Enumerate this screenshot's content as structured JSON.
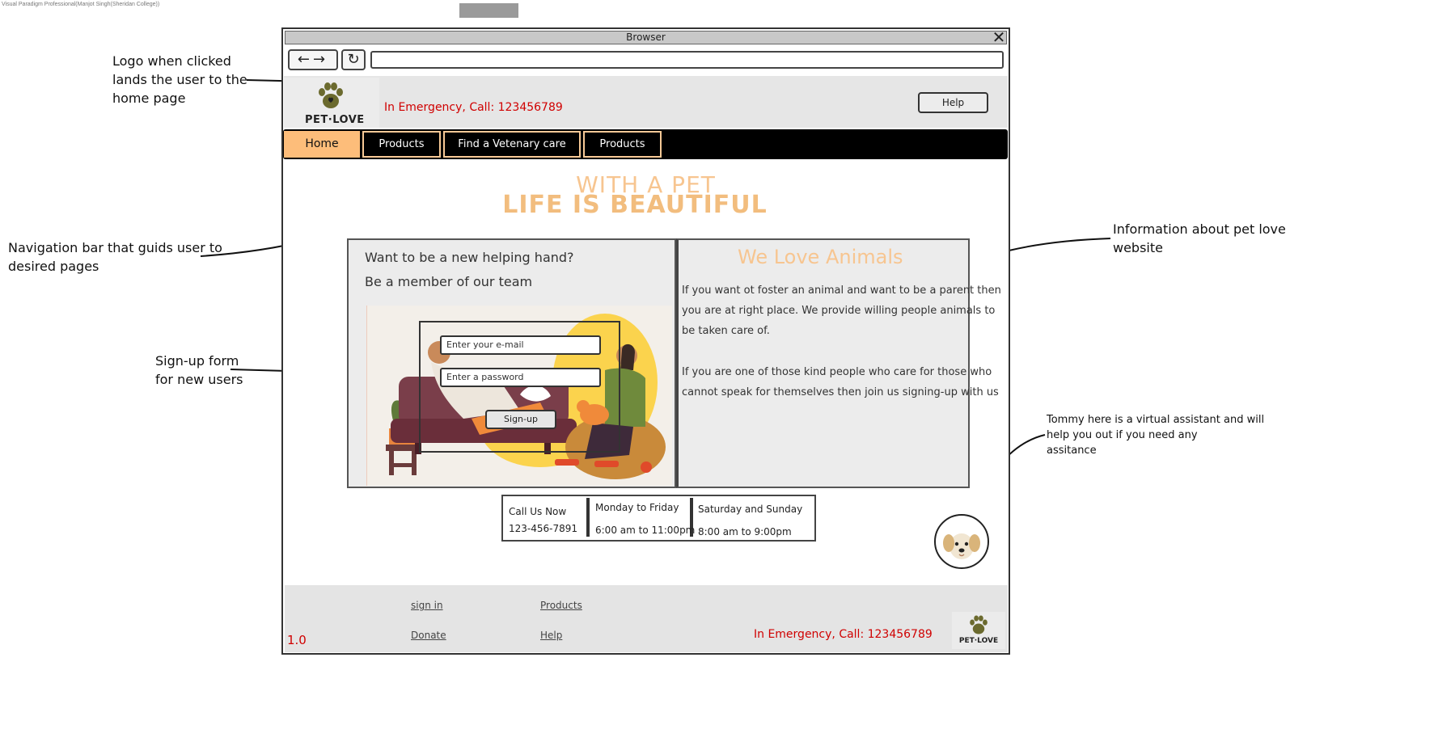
{
  "watermark": "Visual Paradigm Professional(Manjot Singh(Sheridan College))",
  "annotations": {
    "logo": "Logo when clicked\nlands the user to the\nhome page",
    "navigation": "Navigation bar that guids user to\ndesired pages",
    "signup": "Sign-up form\nfor new users",
    "info": "Information about pet love\n website",
    "assistant": "Tommy here is a virtual assistant and will\nhelp you out if you need any\nassitance"
  },
  "browser": {
    "title": "Browser",
    "close_icon": "✕",
    "back_forward": "←→",
    "reload": "↻",
    "url": ""
  },
  "header": {
    "logo_text": "PET·LOVE",
    "emergency": "In Emergency, Call: 123456789",
    "help": "Help"
  },
  "nav": {
    "items": [
      "Home",
      "Products",
      "Find a Vetenary care",
      "Products"
    ]
  },
  "hero": {
    "line1": "WITH A PET",
    "line2": "LIFE IS BEAUTIFUL"
  },
  "join": {
    "line1": "Want to be a new helping hand?",
    "line2": "Be a member of our team",
    "email_placeholder": "Enter your e-mail",
    "password_placeholder": "Enter a password",
    "signup": "Sign-up"
  },
  "about": {
    "title": "We Love Animals",
    "para1_l1": "If you want ot foster an animal and want to be a parent then",
    "para1_l2": "you are at right place. We provide willing people animals to",
    "para1_l3": "be taken care of.",
    "para2_l1": "If you are one of those kind people who care for those who",
    "para2_l2": "cannot speak for themselves then join us signing-up with us"
  },
  "contact": {
    "call_label": "Call Us Now",
    "phone": "123-456-7891",
    "weekdays_label": "Monday to Friday",
    "weekdays_hours": "6:00 am to 11:00pm",
    "weekend_label": "Saturday and Sunday",
    "weekend_hours": "8:00 am to 9:00pm"
  },
  "footer": {
    "sign_in": "sign in",
    "products": "Products",
    "donate": "Donate",
    "help": "Help",
    "version": "1.0",
    "emergency": "In Emergency, Call: 123456789",
    "logo_text": "PET·LOVE"
  },
  "colors": {
    "accent": "#fdbd7a",
    "hero": "#f2bd7e",
    "emergency": "#d00000",
    "logo_paw": "#6b6a2e"
  },
  "icons": [
    "paw-icon",
    "back-icon",
    "forward-icon",
    "reload-icon",
    "close-icon",
    "dog-icon"
  ]
}
